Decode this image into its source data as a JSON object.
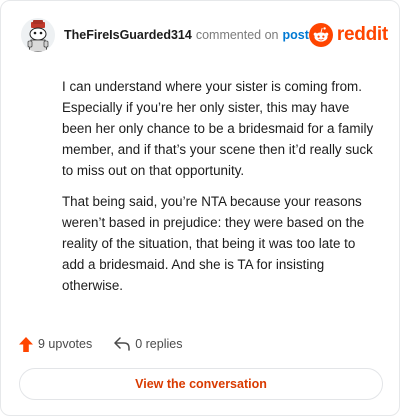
{
  "header": {
    "username": "TheFireIsGuarded314",
    "action_text": "commented on",
    "post_link": "post",
    "brand": "reddit"
  },
  "comment": {
    "paragraphs": [
      "I can understand where your sister is coming from. Especially if you’re her only sister, this may have been her only chance to be a bridesmaid for a family member, and if that’s your scene then it’d really suck to miss out on that opportunity.",
      "That being said, you’re NTA because your reasons weren’t based in prejudice: they were based on the reality of the situation, that being it was too late to add a bridesmaid. And she is TA for insisting otherwise."
    ]
  },
  "actions": {
    "upvotes": "9 upvotes",
    "replies": "0 replies"
  },
  "footer": {
    "view_button": "View the conversation"
  },
  "colors": {
    "brand": "#ff4500",
    "link": "#0079d3",
    "button_text": "#d93a00"
  }
}
